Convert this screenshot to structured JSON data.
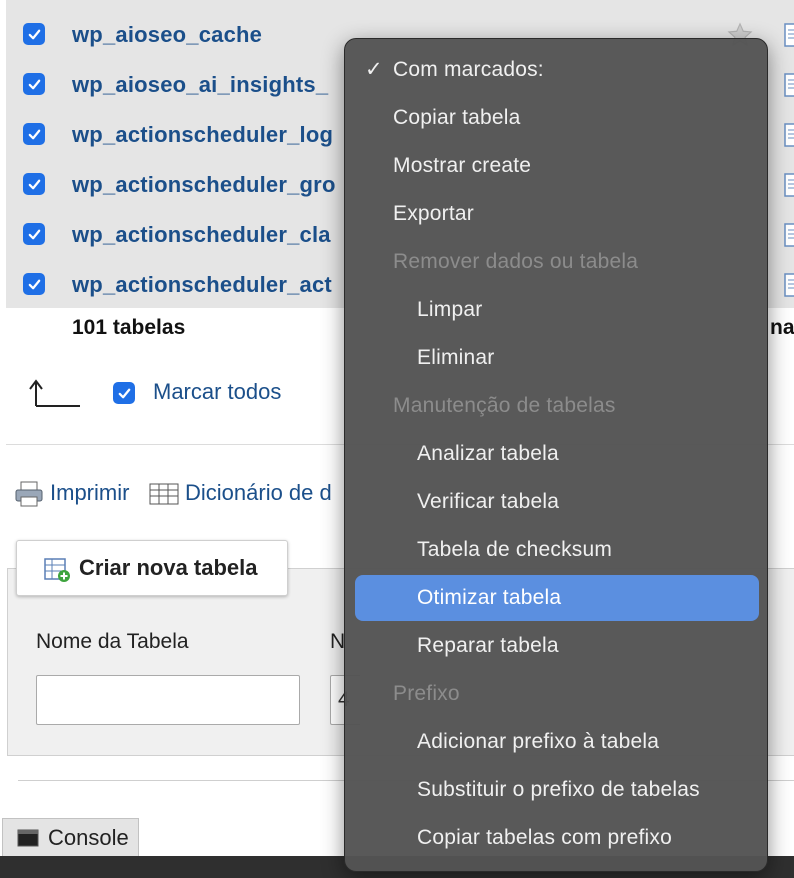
{
  "tables": [
    {
      "name": "wp_aioseo_cache"
    },
    {
      "name": "wp_aioseo_ai_insights_"
    },
    {
      "name": "wp_actionscheduler_log"
    },
    {
      "name": "wp_actionscheduler_gro"
    },
    {
      "name": "wp_actionscheduler_cla"
    },
    {
      "name": "wp_actionscheduler_act"
    }
  ],
  "footer": {
    "count_label": "101 tabelas",
    "tail_label": "na"
  },
  "check_all": {
    "label": "Marcar todos"
  },
  "links": {
    "print": "Imprimir",
    "dictionary": "Dicionário de d"
  },
  "create_table": {
    "button_label": "Criar nova tabela",
    "name_label": "Nome da Tabela",
    "columns_label": "N",
    "columns_value": "4"
  },
  "console": {
    "label": "Console"
  },
  "menu": {
    "header": {
      "check": "✓",
      "label": "Com marcados:"
    },
    "items": [
      {
        "label": "Copiar tabela",
        "kind": "top"
      },
      {
        "label": "Mostrar create",
        "kind": "top"
      },
      {
        "label": "Exportar",
        "kind": "top"
      },
      {
        "label": "Remover dados ou tabela",
        "kind": "group"
      },
      {
        "label": "Limpar",
        "kind": "sub"
      },
      {
        "label": "Eliminar",
        "kind": "sub"
      },
      {
        "label": "Manutenção de tabelas",
        "kind": "group"
      },
      {
        "label": "Analizar tabela",
        "kind": "sub"
      },
      {
        "label": "Verificar tabela",
        "kind": "sub"
      },
      {
        "label": "Tabela de checksum",
        "kind": "sub"
      },
      {
        "label": "Otimizar tabela",
        "kind": "sub",
        "selected": true
      },
      {
        "label": "Reparar tabela",
        "kind": "sub"
      },
      {
        "label": "Prefixo",
        "kind": "group"
      },
      {
        "label": "Adicionar prefixo à tabela",
        "kind": "sub"
      },
      {
        "label": "Substituir o prefixo de tabelas",
        "kind": "sub"
      },
      {
        "label": "Copiar tabelas com prefixo",
        "kind": "sub"
      }
    ]
  },
  "colors": {
    "accent": "#1f6fe6",
    "link": "#1b4f8a",
    "menu_bg": "#545454",
    "menu_selected": "#5b8fe0"
  }
}
